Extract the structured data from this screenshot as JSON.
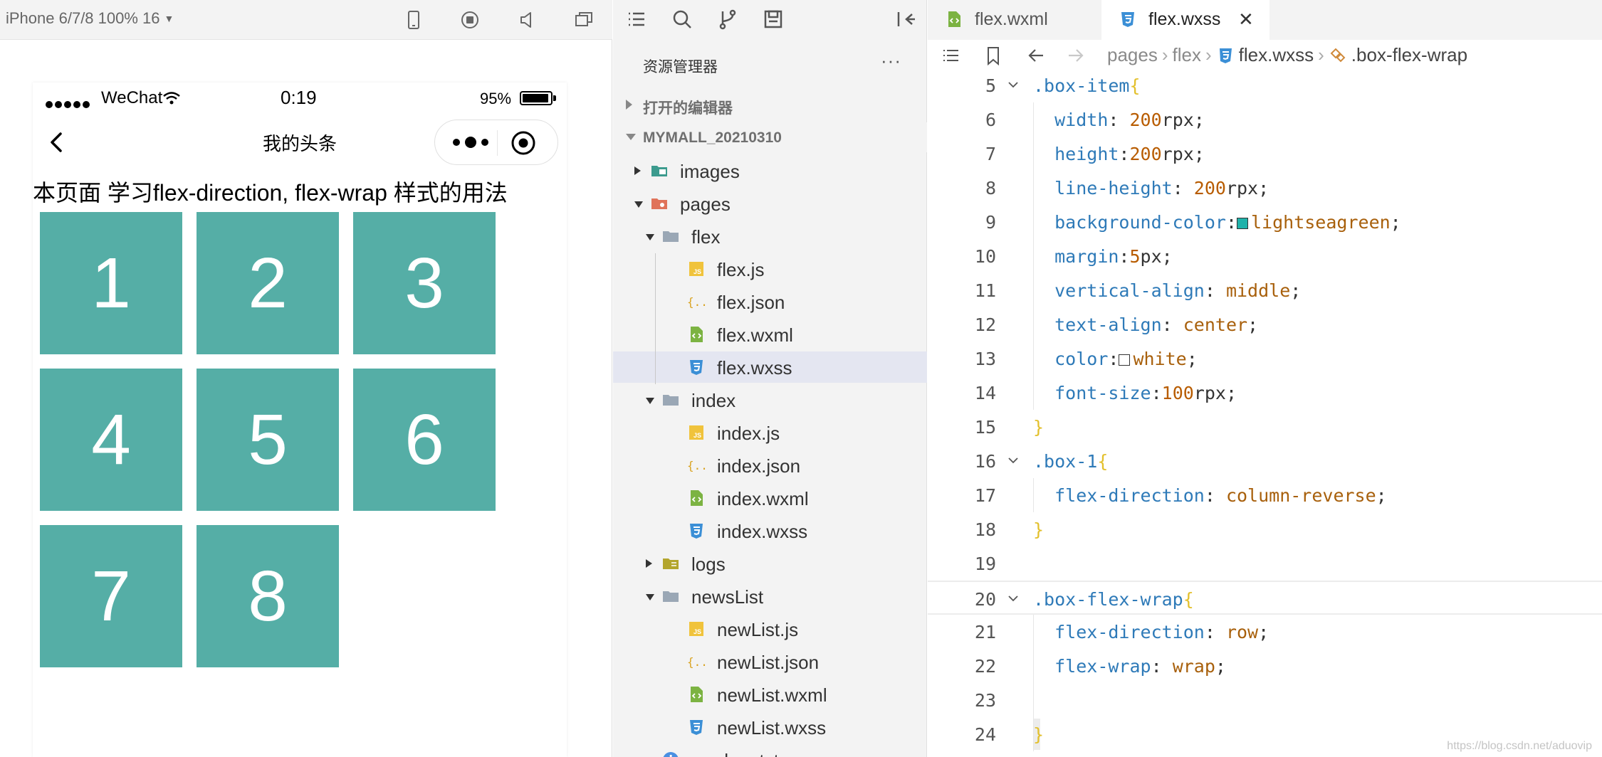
{
  "simulator": {
    "device_label": "iPhone 6/7/8 100% 16",
    "status": {
      "carrier": "WeChat",
      "time": "0:19",
      "battery": "95%"
    },
    "nav_title": "我的头条",
    "description": "本页面 学习flex-direction, flex-wrap 样式的用法",
    "boxes": [
      "1",
      "2",
      "3",
      "4",
      "5",
      "6",
      "7",
      "8"
    ],
    "box_color": "#55aea6"
  },
  "explorer": {
    "title": "资源管理器",
    "more": "···",
    "open_editors": "打开的编辑器",
    "project": "MYMALL_20210310",
    "tree": [
      {
        "label": "images",
        "type": "folder-img",
        "indent": 0,
        "twisty": "right"
      },
      {
        "label": "pages",
        "type": "folder-pages",
        "indent": 0,
        "twisty": "down"
      },
      {
        "label": "flex",
        "type": "folder",
        "indent": 1,
        "twisty": "down"
      },
      {
        "label": "flex.js",
        "type": "js",
        "indent": 2
      },
      {
        "label": "flex.json",
        "type": "json",
        "indent": 2
      },
      {
        "label": "flex.wxml",
        "type": "wxml",
        "indent": 2
      },
      {
        "label": "flex.wxss",
        "type": "wxss",
        "indent": 2,
        "selected": true
      },
      {
        "label": "index",
        "type": "folder",
        "indent": 1,
        "twisty": "down"
      },
      {
        "label": "index.js",
        "type": "js",
        "indent": 2
      },
      {
        "label": "index.json",
        "type": "json",
        "indent": 2
      },
      {
        "label": "index.wxml",
        "type": "wxml",
        "indent": 2
      },
      {
        "label": "index.wxss",
        "type": "wxss",
        "indent": 2
      },
      {
        "label": "logs",
        "type": "folder-logs",
        "indent": 1,
        "twisty": "right"
      },
      {
        "label": "newsList",
        "type": "folder",
        "indent": 1,
        "twisty": "down"
      },
      {
        "label": "newList.js",
        "type": "js",
        "indent": 2
      },
      {
        "label": "newList.json",
        "type": "json",
        "indent": 2
      },
      {
        "label": "newList.wxml",
        "type": "wxml",
        "indent": 2
      },
      {
        "label": "newList.wxss",
        "type": "wxss",
        "indent": 2
      },
      {
        "label": "readme.txt",
        "type": "info",
        "indent": 1
      }
    ]
  },
  "editor": {
    "tabs": [
      {
        "label": "flex.wxml",
        "active": false
      },
      {
        "label": "flex.wxss",
        "active": true,
        "close": "✕"
      }
    ],
    "breadcrumb": [
      "pages",
      "flex",
      "flex.wxss",
      ".box-flex-wrap"
    ],
    "lines": [
      {
        "n": "5",
        "fold": true,
        "html": "<span class='sel'>.box-item</span><span class='brace'>{</span>"
      },
      {
        "n": "6",
        "html": "  <span class='prop'>width</span>: <span class='num'>200</span>rpx;"
      },
      {
        "n": "7",
        "html": "  <span class='prop'>height</span>:<span class='num'>200</span>rpx;"
      },
      {
        "n": "8",
        "html": "  <span class='prop'>line-height</span>: <span class='num'>200</span>rpx;"
      },
      {
        "n": "9",
        "html": "  <span class='prop'>background-color</span>:<span class='swatch' style='background:#20b2aa'></span><span class='val'>lightseagreen</span>;"
      },
      {
        "n": "10",
        "html": "  <span class='prop'>margin</span>:<span class='num'>5</span>px;"
      },
      {
        "n": "11",
        "html": "  <span class='prop'>vertical-align</span>: <span class='val'>middle</span>;"
      },
      {
        "n": "12",
        "html": "  <span class='prop'>text-align</span>: <span class='val'>center</span>;"
      },
      {
        "n": "13",
        "html": "  <span class='prop'>color</span>:<span class='swatch' style='background:#fff'></span><span class='val'>white</span>;"
      },
      {
        "n": "14",
        "html": "  <span class='prop'>font-size</span>:<span class='num'>100</span>rpx;"
      },
      {
        "n": "15",
        "html": "<span class='brace'>}</span>"
      },
      {
        "n": "16",
        "fold": true,
        "html": "<span class='sel'>.box-1</span><span class='brace'>{</span>"
      },
      {
        "n": "17",
        "html": "  <span class='prop'>flex-direction</span>: <span class='val'>column-reverse</span>;"
      },
      {
        "n": "18",
        "html": "<span class='brace'>}</span>"
      },
      {
        "n": "19",
        "html": ""
      },
      {
        "n": "20",
        "fold": true,
        "hl": true,
        "html": "<span class='sel'>.box-flex-wrap</span><span class='brace'>{</span>"
      },
      {
        "n": "21",
        "html": "  <span class='prop'>flex-direction</span>: <span class='val'>row</span>;"
      },
      {
        "n": "22",
        "html": "  <span class='prop'>flex-wrap</span>: <span class='val'>wrap</span>;"
      },
      {
        "n": "23",
        "html": ""
      },
      {
        "n": "24",
        "html": "<span class='brace'>}</span>"
      }
    ],
    "watermark": "https://blog.csdn.net/aduovip"
  }
}
